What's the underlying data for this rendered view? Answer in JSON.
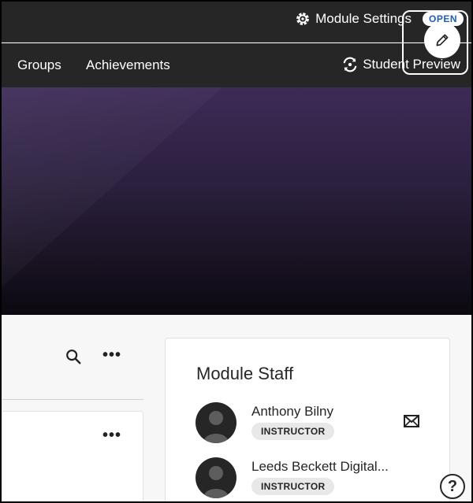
{
  "header": {
    "settings_label": "Module Settings",
    "status_badge": "OPEN",
    "settings_icon": "gear-icon"
  },
  "nav": {
    "items": [
      {
        "label": "Groups"
      },
      {
        "label": "Achievements"
      }
    ],
    "preview_label": "Student Preview",
    "preview_icon": "refresh-eye-icon"
  },
  "banner": {
    "edit_icon": "pencil-icon"
  },
  "content": {
    "search_icon": "search-icon",
    "more_label": "•••"
  },
  "staff": {
    "title": "Module Staff",
    "people": [
      {
        "name": "Anthony Bilny",
        "role": "INSTRUCTOR"
      },
      {
        "name": "Leeds Beckett Digital...",
        "role": "INSTRUCTOR"
      }
    ]
  },
  "help": {
    "label": "?"
  },
  "colors": {
    "topbar": "#262626",
    "badge_text": "#1c5db8",
    "banner_top": "#3d2b57",
    "banner_bottom": "#0c0910"
  }
}
